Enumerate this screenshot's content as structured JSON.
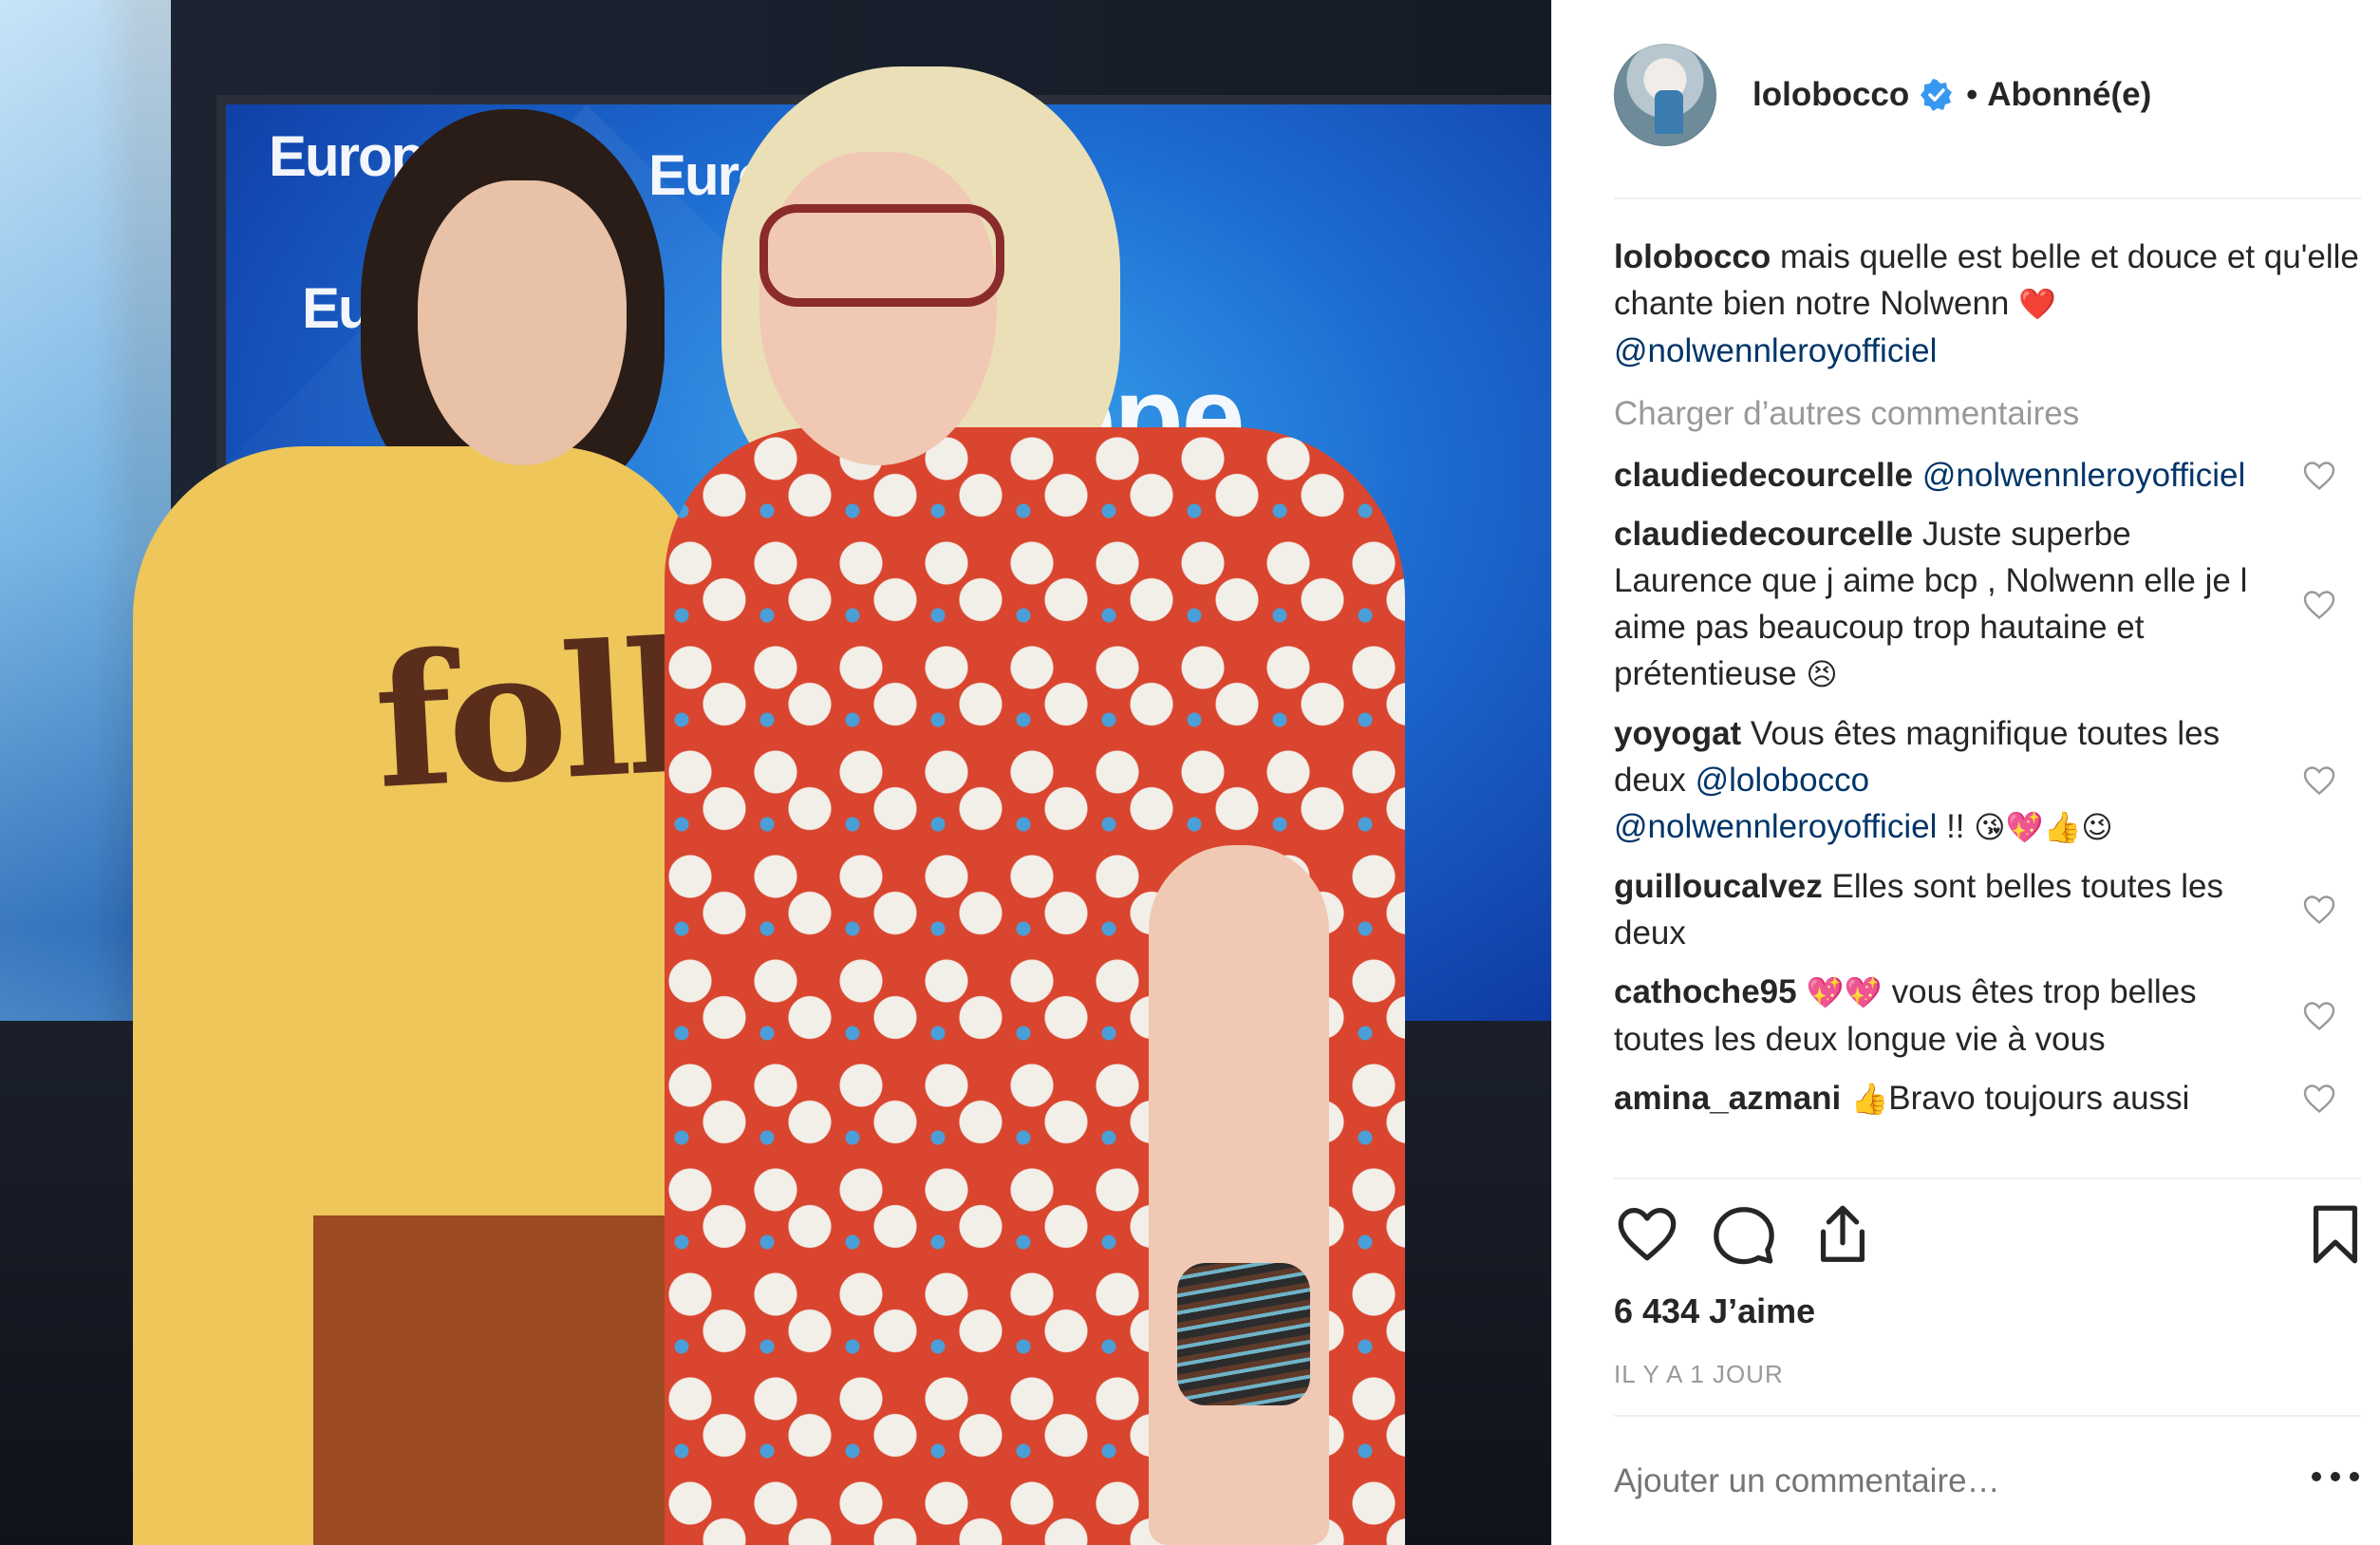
{
  "photo": {
    "brand_text": "Europe 1",
    "brand_text_short": "Europe",
    "sweater_text": "folk"
  },
  "post": {
    "username": "lolobocco",
    "follow_state": "Abonné(e)",
    "separator": "•",
    "caption": {
      "username": "lolobocco",
      "text": " mais quelle est belle et douce et qu'elle chante bien notre Nolwenn ",
      "emoji": "❤️",
      "mention": "@nolwennleroyofficiel"
    },
    "load_more": "Charger d’autres commentaires",
    "comments": [
      {
        "username": "claudiedecourcelle",
        "parts": [
          " ",
          "@nolwennleroyofficiel"
        ]
      },
      {
        "username": "claudiedecourcelle",
        "text": " Juste superbe Laurence que j aime bcp , Nolwenn elle je l aime pas beaucoup trop hautaine et prétentieuse ",
        "emoji": "😣"
      },
      {
        "username": "yoyogat",
        "text": " Vous êtes magnifique toutes les deux ",
        "mention1": "@lolobocco",
        "mention2": "@nolwennleroyofficiel",
        "tail": " !! ",
        "emoji": "😘💖👍😉"
      },
      {
        "username": "guilloucalvez",
        "text": " Elles sont belles toutes les deux"
      },
      {
        "username": "cathoche95",
        "emoji": " 💖💖 ",
        "text": "vous êtes trop belles toutes les deux longue vie à vous"
      },
      {
        "username": "amina_azmani",
        "emoji": " 👍",
        "text": "Bravo toujours aussi"
      }
    ],
    "likes": "6 434 J’aime",
    "timestamp": "IL Y A 1 JOUR",
    "add_comment_placeholder": "Ajouter un commentaire…",
    "icons": {
      "like": "heart-icon",
      "comment": "comment-icon",
      "share": "share-icon",
      "save": "bookmark-icon",
      "verified": "verified-badge-icon",
      "more": "more-options-icon"
    },
    "colors": {
      "mention": "#003569",
      "muted": "#999999",
      "text": "#262626",
      "verified": "#3897f0"
    }
  }
}
